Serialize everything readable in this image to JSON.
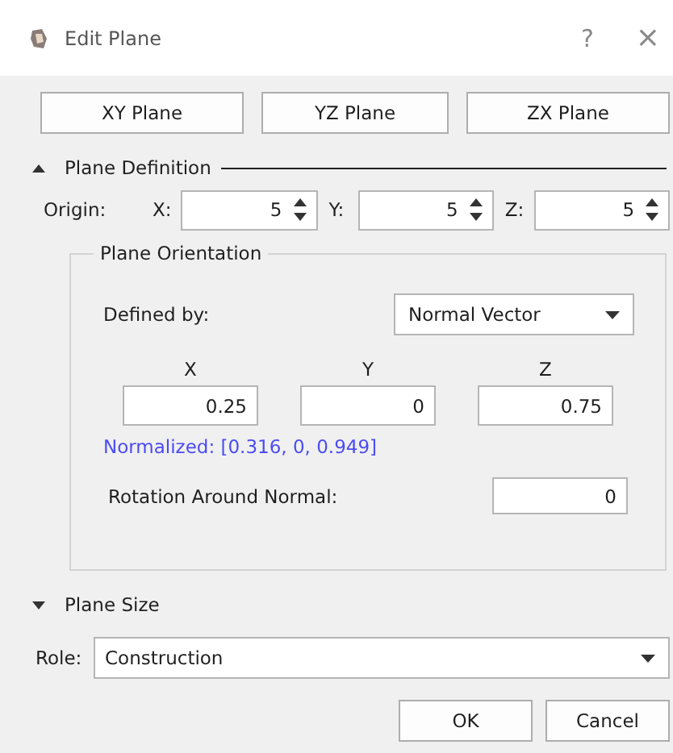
{
  "window": {
    "title": "Edit Plane",
    "help": "?",
    "close": "×"
  },
  "preset_buttons": [
    "XY Plane",
    "YZ Plane",
    "ZX Plane"
  ],
  "plane_definition": {
    "title": "Plane Definition",
    "expanded": true,
    "origin_label": "Origin:",
    "origin": [
      {
        "label": "X:",
        "value": "5"
      },
      {
        "label": "Y:",
        "value": "5"
      },
      {
        "label": "Z:",
        "value": "5"
      }
    ],
    "orientation": {
      "title": "Plane Orientation",
      "defined_by_label": "Defined by:",
      "defined_by": "Normal Vector",
      "vector": [
        {
          "label": "X",
          "value": "0.25"
        },
        {
          "label": "Y",
          "value": "0"
        },
        {
          "label": "Z",
          "value": "0.75"
        }
      ],
      "normalized": "Normalized: [0.316, 0, 0.949]",
      "rotation_label": "Rotation Around Normal:",
      "rotation": "0"
    }
  },
  "plane_size": {
    "title": "Plane Size",
    "expanded": false
  },
  "role": {
    "label": "Role:",
    "value": "Construction"
  },
  "buttons": [
    "OK",
    "Cancel"
  ]
}
